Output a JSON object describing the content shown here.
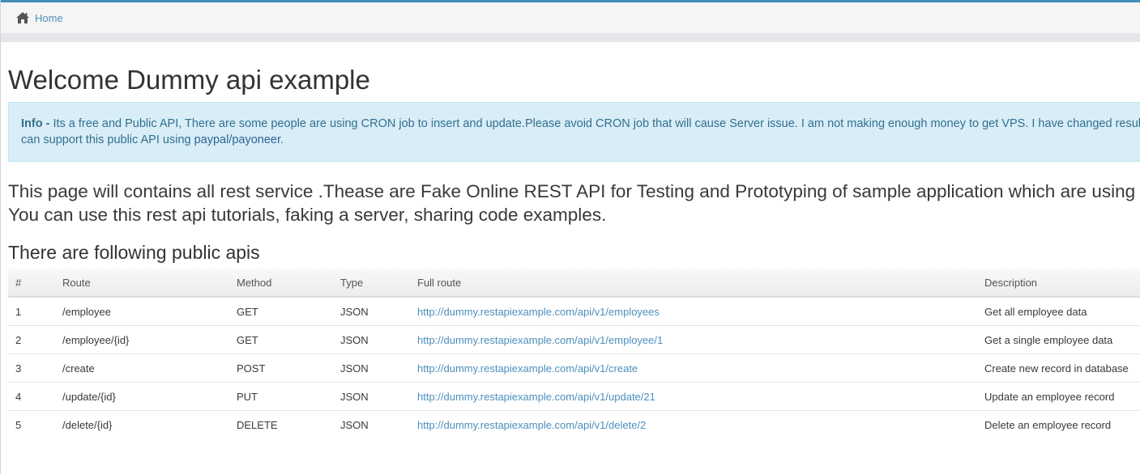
{
  "breadcrumb": {
    "home_label": "Home"
  },
  "page": {
    "title": "Welcome Dummy api example",
    "info": {
      "label": "Info - ",
      "text_line1": "Its a free and Public API, There are some people are using CRON job to insert and update.Please avoid CRON job that will cause Server issue. I am not making enough money to get VPS. I have changed results",
      "text_line2_prefix": "can support this public API using ",
      "link": "paypal/payoneer",
      "text_line2_suffix": "."
    },
    "lead_line1": "This page will contains all rest service .Thease are Fake Online REST API for Testing and Prototyping of sample application which are using rest call to d",
    "lead_line2": "You can use this rest api tutorials, faking a server, sharing code examples.",
    "subtitle": "There are following public apis"
  },
  "table": {
    "headers": [
      "#",
      "Route",
      "Method",
      "Type",
      "Full route",
      "Description"
    ],
    "rows": [
      {
        "num": "1",
        "route": "/employee",
        "method": "GET",
        "type": "JSON",
        "full_route": "http://dummy.restapiexample.com/api/v1/employees",
        "description": "Get all employee data"
      },
      {
        "num": "2",
        "route": "/employee/{id}",
        "method": "GET",
        "type": "JSON",
        "full_route": "http://dummy.restapiexample.com/api/v1/employee/1",
        "description": "Get a single employee data"
      },
      {
        "num": "3",
        "route": "/create",
        "method": "POST",
        "type": "JSON",
        "full_route": "http://dummy.restapiexample.com/api/v1/create",
        "description": "Create new record in database"
      },
      {
        "num": "4",
        "route": "/update/{id}",
        "method": "PUT",
        "type": "JSON",
        "full_route": "http://dummy.restapiexample.com/api/v1/update/21",
        "description": "Update an employee record"
      },
      {
        "num": "5",
        "route": "/delete/{id}",
        "method": "DELETE",
        "type": "JSON",
        "full_route": "http://dummy.restapiexample.com/api/v1/delete/2",
        "description": "Delete an employee record"
      }
    ]
  },
  "colors": {
    "accent": "#438eb9",
    "link": "#4c8fbd",
    "info_bg": "#d9edf7",
    "info_text": "#31708f"
  },
  "icons": {
    "home": "home-icon"
  }
}
